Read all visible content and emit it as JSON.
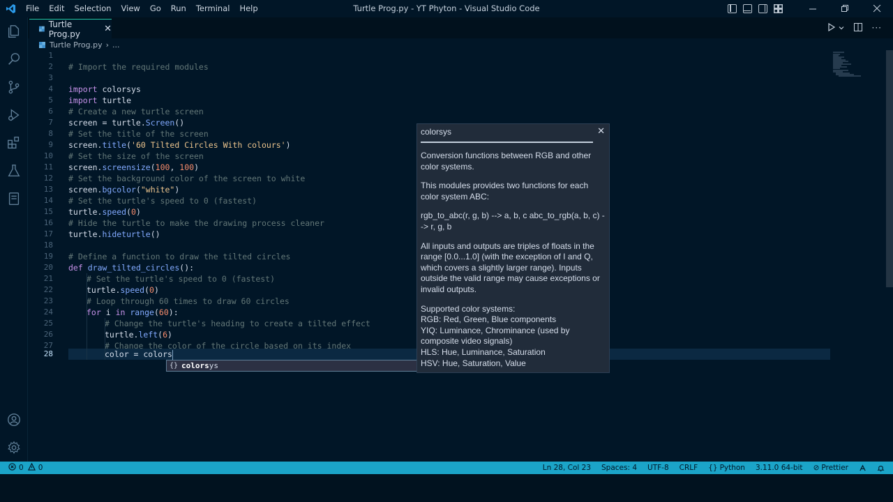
{
  "titlebar": {
    "menu": [
      "File",
      "Edit",
      "Selection",
      "View",
      "Go",
      "Run",
      "Terminal",
      "Help"
    ],
    "window_title": "Turtle Prog.py - YT Phyton - Visual Studio Code"
  },
  "tab": {
    "label": "Turtle Prog.py",
    "close": "✕"
  },
  "breadcrumb": {
    "file": "Turtle Prog.py",
    "sep": "›",
    "more": "..."
  },
  "editor": {
    "current_line": 28,
    "lines": [
      {
        "n": "1"
      },
      {
        "n": "2"
      },
      {
        "n": "3"
      },
      {
        "n": "4"
      },
      {
        "n": "5"
      },
      {
        "n": "6"
      },
      {
        "n": "7"
      },
      {
        "n": "8"
      },
      {
        "n": "9"
      },
      {
        "n": "10"
      },
      {
        "n": "11"
      },
      {
        "n": "12"
      },
      {
        "n": "13"
      },
      {
        "n": "14"
      },
      {
        "n": "15"
      },
      {
        "n": "16"
      },
      {
        "n": "17"
      },
      {
        "n": "18"
      },
      {
        "n": "19"
      },
      {
        "n": "20"
      },
      {
        "n": "21"
      },
      {
        "n": "22"
      },
      {
        "n": "23"
      },
      {
        "n": "24"
      },
      {
        "n": "25"
      },
      {
        "n": "26"
      },
      {
        "n": "27"
      },
      {
        "n": "28"
      }
    ],
    "code": {
      "l2": "# Import the required modules",
      "l4_kw": "import",
      "l4_mod": "colorsys",
      "l5_kw": "import",
      "l5_mod": "turtle",
      "l6": "# Create a new turtle screen",
      "l7_a": "screen = turtle.",
      "l7_fn": "Screen",
      "l7_b": "()",
      "l8": "# Set the title of the screen",
      "l9_a": "screen.",
      "l9_fn": "title",
      "l9_b": "(",
      "l9_str": "'60 Tilted Circles With colours'",
      "l9_c": ")",
      "l10": "# Set the size of the screen",
      "l11_a": "screen.",
      "l11_fn": "screensize",
      "l11_b": "(",
      "l11_n1": "100",
      "l11_c": ", ",
      "l11_n2": "100",
      "l11_d": ")",
      "l12": "# Set the background color of the screen to white",
      "l13_a": "screen.",
      "l13_fn": "bgcolor",
      "l13_b": "(",
      "l13_str": "\"white\"",
      "l13_c": ")",
      "l14": "# Set the turtle's speed to 0 (fastest)",
      "l15_a": "turtle.",
      "l15_fn": "speed",
      "l15_b": "(",
      "l15_n": "0",
      "l15_c": ")",
      "l16": "# Hide the turtle to make the drawing process cleaner",
      "l17_a": "turtle.",
      "l17_fn": "hideturtle",
      "l17_b": "()",
      "l19": "# Define a function to draw the tilted circles",
      "l20_kw": "def",
      "l20_fn": "draw_tilted_circles",
      "l20_b": "():",
      "l21": "# Set the turtle's speed to 0 (fastest)",
      "l22_a": "turtle.",
      "l22_fn": "speed",
      "l22_b": "(",
      "l22_n": "0",
      "l22_c": ")",
      "l23": "# Loop through 60 times to draw 60 circles",
      "l24_kw1": "for",
      "l24_v": " i ",
      "l24_kw2": "in",
      "l24_fn": "range",
      "l24_b": "(",
      "l24_n": "60",
      "l24_c": "):",
      "l25": "# Change the turtle's heading to create a tilted effect",
      "l26_a": "turtle.",
      "l26_fn": "left",
      "l26_b": "(",
      "l26_n": "6",
      "l26_c": ")",
      "l27": "# Change the color of the circle based on its index",
      "l28": "color = colors"
    }
  },
  "suggest": {
    "symbol": "{}",
    "match": "colors",
    "rest": "ys"
  },
  "docs": {
    "header": "colorsys",
    "close": "✕",
    "p1": "Conversion functions between RGB and other color systems.",
    "p2": "This modules provides two functions for each color system ABC:",
    "p3": "  rgb_to_abc(r, g, b) --> a, b, c abc_to_rgb(a, b, c) --> r, g, b",
    "p4": "All inputs and outputs are triples of floats in the range [0.0...1.0] (with the exception of I and Q, which covers a slightly larger range). Inputs outside the valid range may cause exceptions or invalid outputs.",
    "p5_title": "Supported color systems:",
    "p5_l1": "RGB: Red, Green, Blue components",
    "p5_l2": "YIQ: Luminance, Chrominance (used by composite video signals)",
    "p5_l3": "HLS: Hue, Luminance, Saturation",
    "p5_l4": "HSV: Hue, Saturation, Value"
  },
  "status": {
    "errors": "0",
    "warnings": "0",
    "position": "Ln 28, Col 23",
    "spaces": "Spaces: 4",
    "encoding": "UTF-8",
    "eol": "CRLF",
    "language": "Python",
    "interpreter": "3.11.0 64-bit",
    "formatter": "Prettier"
  },
  "colors": {
    "accent": "#1ba4c8",
    "editor_bg": "#011627",
    "current_line": "#0b2942"
  }
}
